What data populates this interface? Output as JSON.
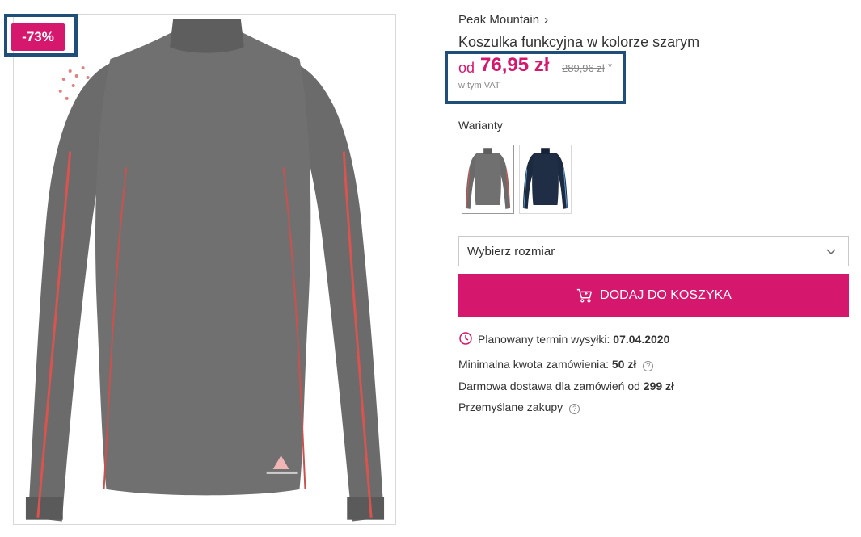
{
  "product": {
    "discount_badge": "-73%",
    "brand": "Peak Mountain",
    "brand_chevron": "›",
    "title": "Koszulka funkcyjna w kolorze szarym",
    "image_icon": "shirt-image",
    "colors": {
      "accent": "#d6176e",
      "shirt_gray": "#6b6b6b",
      "shirt_stripe": "#d9534f",
      "variant_navy": "#1c2a3f",
      "highlight_frame": "#1f4e79"
    }
  },
  "price": {
    "from": "od",
    "current": "76,95 zł",
    "old": "289,96 zł",
    "old_mark": "*",
    "vat_note": "w tym VAT"
  },
  "variants": {
    "label": "Warianty",
    "items": [
      {
        "name": "szary",
        "color": "#6b6b6b",
        "selected": true
      },
      {
        "name": "granatowy",
        "color": "#1c2a3f",
        "selected": false
      }
    ]
  },
  "size_select": {
    "label": "Wybierz rozmiar",
    "icon": "chevron-down-icon"
  },
  "cart_button": {
    "label": "DODAJ DO KOSZYKA",
    "icon": "cart-icon"
  },
  "info": {
    "shipping_label": "Planowany termin wysyłki:",
    "shipping_date": "07.04.2020",
    "min_order_label": "Minimalna kwota zamówienia:",
    "min_order_value": "50 zł",
    "free_shipping_label": "Darmowa dostawa dla zamówień od",
    "free_shipping_value": "299 zł",
    "thoughtful_label": "Przemyślane zakupy",
    "help_glyph": "?"
  }
}
